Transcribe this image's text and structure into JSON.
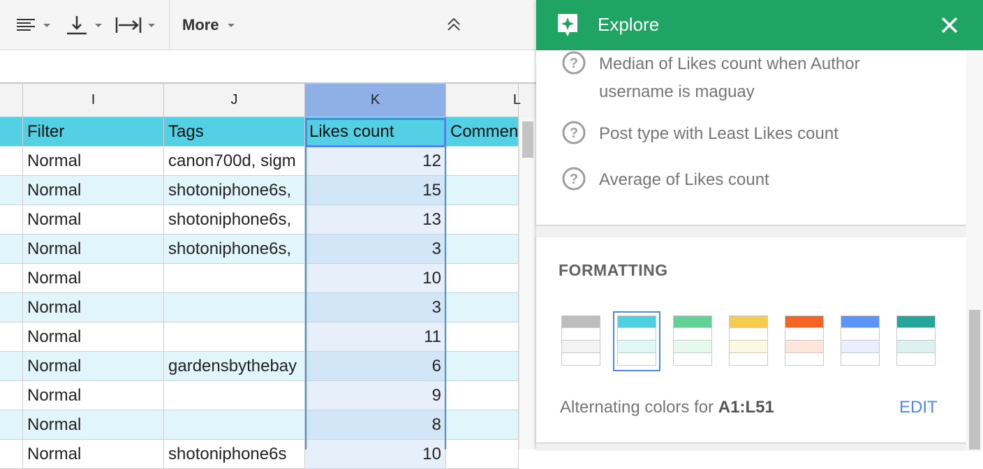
{
  "toolbar": {
    "more_label": "More",
    "icons": [
      "align-left-icon",
      "valign-bottom-icon",
      "text-wrap-icon",
      "collapse-toolbar-icon"
    ]
  },
  "columns": [
    "I",
    "J",
    "K",
    "L"
  ],
  "header_row": [
    "Filter",
    "Tags",
    "Likes count",
    "Commen"
  ],
  "rows": [
    {
      "filter": "Normal",
      "tags": "canon700d, sigm",
      "likes": "12"
    },
    {
      "filter": "Normal",
      "tags": "shotoniphone6s,",
      "likes": "15"
    },
    {
      "filter": "Normal",
      "tags": "shotoniphone6s,",
      "likes": "13"
    },
    {
      "filter": "Normal",
      "tags": "shotoniphone6s,",
      "likes": "3"
    },
    {
      "filter": "Normal",
      "tags": "",
      "likes": "10"
    },
    {
      "filter": "Normal",
      "tags": "",
      "likes": "3"
    },
    {
      "filter": "Normal",
      "tags": "",
      "likes": "11"
    },
    {
      "filter": "Normal",
      "tags": "gardensbythebay",
      "likes": "6"
    },
    {
      "filter": "Normal",
      "tags": "",
      "likes": "9"
    },
    {
      "filter": "Normal",
      "tags": "",
      "likes": "8"
    },
    {
      "filter": "Normal",
      "tags": "shotoniphone6s",
      "likes": "10"
    }
  ],
  "explore": {
    "title": "Explore",
    "questions": [
      {
        "line1": "Median of Likes count when Author",
        "line2": "username is maguay"
      },
      {
        "line1": "Post type with Least Likes count",
        "line2": ""
      },
      {
        "line1": "Average of Likes count",
        "line2": ""
      }
    ],
    "formatting": {
      "title": "FORMATTING",
      "swatches": [
        {
          "header": "#bdbdbd",
          "alt": "#f3f3f3"
        },
        {
          "header": "#4dd0e1",
          "alt": "#e0f7fa"
        },
        {
          "header": "#63d297",
          "alt": "#e7f9ef"
        },
        {
          "header": "#f7cb4d",
          "alt": "#fef8e3"
        },
        {
          "header": "#f46524",
          "alt": "#ffe6dd"
        },
        {
          "header": "#5b95f9",
          "alt": "#e8f0fe"
        },
        {
          "header": "#26a69a",
          "alt": "#ddf2f0"
        }
      ],
      "selected_index": 1,
      "alt_text_prefix": "Alternating colors for ",
      "alt_range": "A1:L51",
      "edit_label": "EDIT"
    }
  },
  "colors": {
    "header_fill": "#53d0e3",
    "band_fill": "#e0f6fa",
    "selection": "#4f86ec",
    "explore_green": "#1fa463"
  }
}
